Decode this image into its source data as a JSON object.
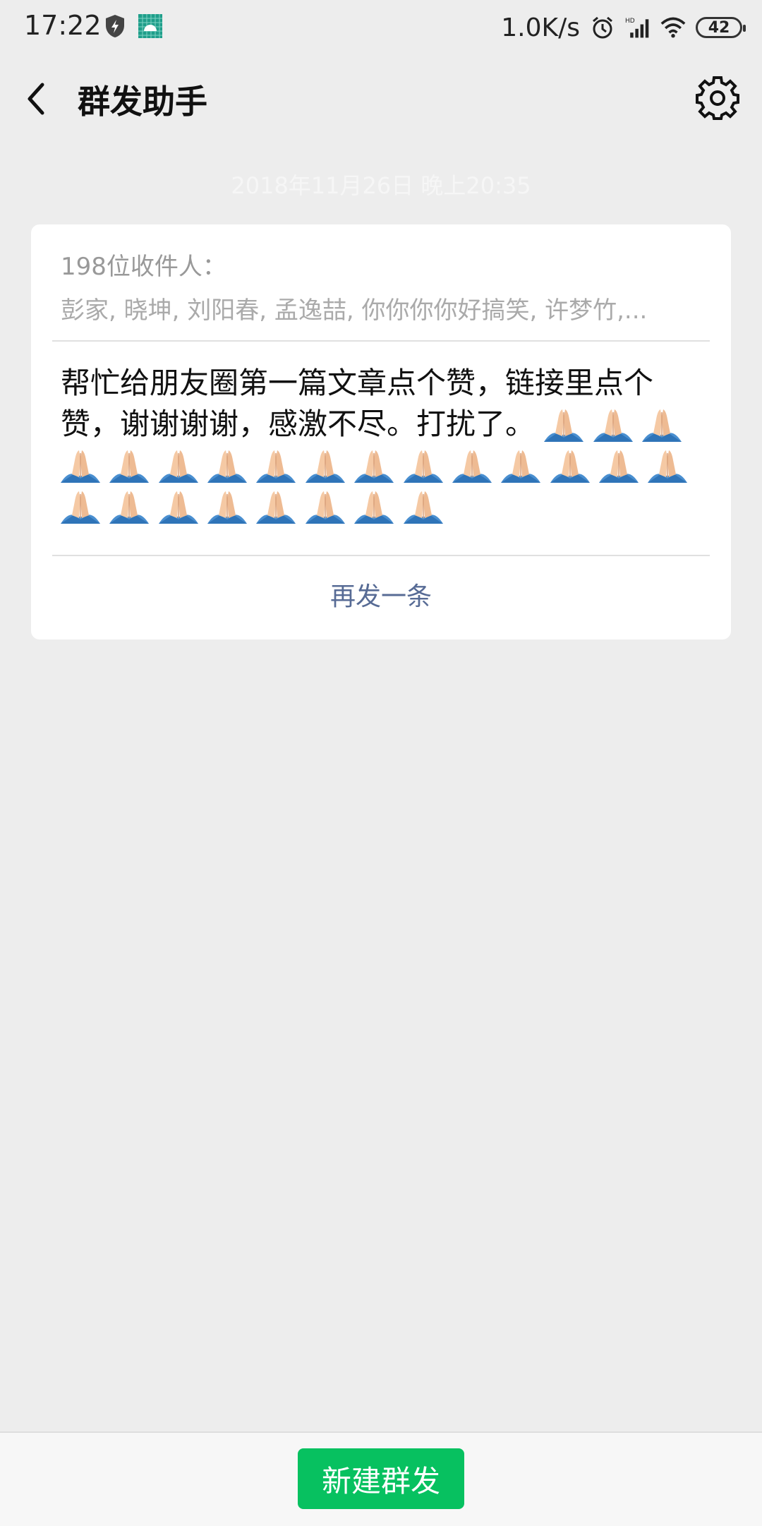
{
  "status_bar": {
    "time": "17:22",
    "network_speed": "1.0K/s",
    "battery": "42",
    "icons": [
      "shield-icon",
      "android-app-icon",
      "alarm-icon",
      "hd-signal-icon",
      "wifi-icon",
      "battery-icon"
    ]
  },
  "header": {
    "title": "群发助手",
    "back_icon": "chevron-left-icon",
    "settings_icon": "gear-icon"
  },
  "timestamp": "2018年11月26日 晚上20:35",
  "card": {
    "recipients_title": "198位收件人：",
    "recipients_names": "彭家, 晓坤, 刘阳春, 孟逸喆, 你你你你好搞笑, 许梦竹,...",
    "message_text": "帮忙给朋友圈第一篇文章点个赞，链接里点个赞，谢谢谢谢，感激不尽。打扰了。",
    "emoji": "folded-hands-icon",
    "emoji_count": 24,
    "resend_label": "再发一条"
  },
  "bottom": {
    "new_broadcast_label": "新建群发"
  },
  "colors": {
    "background": "#ededed",
    "accent_green": "#07c160",
    "link_blue": "#576b95"
  }
}
